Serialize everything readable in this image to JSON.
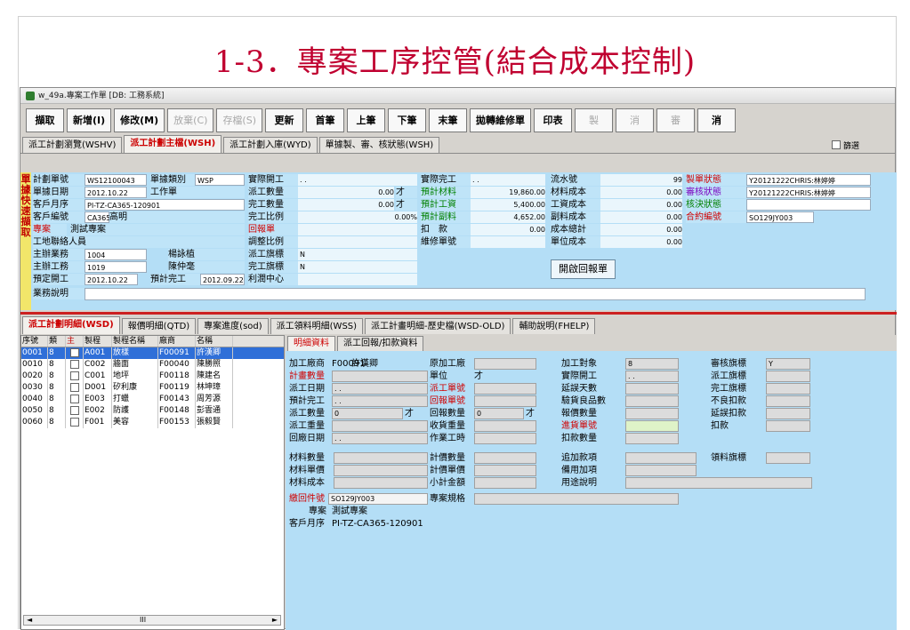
{
  "slide": {
    "title": "1-3．專案工序控管(結合成本控制)"
  },
  "window": {
    "title": "w_49a.專案工作單 [DB: 工務系統]"
  },
  "toolbar": [
    {
      "label": "擷取",
      "enabled": true
    },
    {
      "label": "新增(I)",
      "enabled": true
    },
    {
      "label": "修改(M)",
      "enabled": true
    },
    {
      "label": "放棄(C)",
      "enabled": false
    },
    {
      "label": "存檔(S)",
      "enabled": false
    },
    {
      "label": "更新",
      "enabled": true
    },
    {
      "label": "首筆",
      "enabled": true
    },
    {
      "label": "上筆",
      "enabled": true
    },
    {
      "label": "下筆",
      "enabled": true
    },
    {
      "label": "末筆",
      "enabled": true
    },
    {
      "label": "拋轉維修單",
      "enabled": true
    },
    {
      "label": "印表",
      "enabled": true
    },
    {
      "label": "製",
      "enabled": false
    },
    {
      "label": "消",
      "enabled": false
    },
    {
      "label": "審",
      "enabled": false
    },
    {
      "label": "消",
      "enabled": true
    }
  ],
  "top_tabs": [
    "派工計劃瀏覽(WSHV)",
    "派工計劃主檔(WSH)",
    "派工計劃入庫(WYD)",
    "單據製、審、核狀態(WSH)"
  ],
  "filter_label": "篩選",
  "sidebar_strip": "單據快速擷取",
  "header": {
    "plan_no_label": "計劃單號",
    "plan_no": "WS12100043",
    "doc_type_label": "單據類別",
    "doc_type": "WSP",
    "doc_date_label": "單據日期",
    "doc_date": "2012.10.22",
    "doc_type_name": "工作單",
    "cust_order_label": "客戶月序",
    "cust_order": "PI-TZ-CA365-120901",
    "cust_code_label": "客戶編號",
    "cust_code": "CA365",
    "cust_name": "高明",
    "project_label": "專案",
    "project": "測試專案",
    "site_contact_label": "工地聯絡人員",
    "sales_label": "主辦業務",
    "sales_code": "1004",
    "sales_name": "楊詠植",
    "engineer_label": "主辦工務",
    "engineer_code": "1019",
    "engineer_name": "陳仲毫",
    "planned_start_label": "預定開工",
    "planned_start": "2012.10.22",
    "planned_finish_label": "預計完工",
    "planned_finish": "2012.09.22",
    "notes_label": "業務說明",
    "actual_start_label": "實際開工",
    "actual_start": ". .",
    "dispatch_qty_label": "派工數量",
    "dispatch_qty": "0.00",
    "dispatch_unit": "才",
    "complete_qty_label": "完工數量",
    "complete_qty": "0.00",
    "complete_unit": "才",
    "complete_ratio_label": "完工比例",
    "complete_ratio": "0.00%",
    "return_doc_label": "回報單",
    "adjust_ratio_label": "調整比例",
    "dispatch_flag_label": "派工旗標",
    "dispatch_flag": "N",
    "complete_flag_label": "完工旗標",
    "complete_flag": "N",
    "profit_center_label": "利潤中心",
    "actual_finish_label": "實際完工",
    "actual_finish": ". .",
    "est_material_label": "預計材料",
    "est_material": "19,860.00",
    "est_labor_label": "預計工資",
    "est_labor": "5,400.00",
    "est_sub_label": "預計副料",
    "est_sub": "4,652.00",
    "deduct_label": "扣　款",
    "deduct": "0.00",
    "repair_no_label": "維修單號",
    "serial_label": "流水號",
    "serial": "99",
    "material_cost_label": "材料成本",
    "material_cost": "0.00",
    "labor_cost_label": "工資成本",
    "labor_cost": "0.00",
    "sub_cost_label": "副料成本",
    "sub_cost": "0.00",
    "total_cost_label": "成本總計",
    "total_cost": "0.00",
    "unit_cost_label": "單位成本",
    "unit_cost": "0.00",
    "open_report_button": "開啟回報單",
    "doc_status_label": "製單狀態",
    "doc_status": "Y20121222CHRIS:林婷婷",
    "review_status_label": "審核狀態",
    "review_status": "Y20121222CHRIS:林婷婷",
    "approve_status_label": "核決狀態",
    "contract_no_label": "合約編號",
    "contract_no": "SO129JY003"
  },
  "bottom_tabs": [
    "派工計劃明細(WSD)",
    "報價明細(QTD)",
    "專案進度(sod)",
    "派工領料明細(WSS)",
    "派工計畫明細-歷史檔(WSD-OLD)",
    "輔助說明(FHELP)"
  ],
  "grid": {
    "columns": [
      "序號",
      "類",
      "主",
      "製程",
      "製程名稱",
      "廠商",
      "名稱"
    ],
    "rows": [
      [
        "0001",
        "8",
        "",
        "A001",
        "放樣",
        "F00091",
        "許漢卿"
      ],
      [
        "0010",
        "8",
        "",
        "C002",
        "牆面",
        "F00040",
        "陳勝照"
      ],
      [
        "0020",
        "8",
        "",
        "C001",
        "地坪",
        "F00118",
        "陳建名"
      ],
      [
        "0030",
        "8",
        "",
        "D001",
        "矽利康",
        "F00119",
        "林坤璋"
      ],
      [
        "0040",
        "8",
        "",
        "E003",
        "打蠟",
        "F00143",
        "周芳源"
      ],
      [
        "0050",
        "8",
        "",
        "E002",
        "防護",
        "F00148",
        "彭雲通"
      ],
      [
        "0060",
        "8",
        "",
        "F001",
        "美容",
        "F00153",
        "張毅賢"
      ]
    ],
    "scroll_mark": "III"
  },
  "detail_tabs": [
    "明細資料",
    "派工回報/扣款資料"
  ],
  "detail": {
    "vendor_label": "加工廠商",
    "vendor_code": "F00091",
    "vendor_name": "許漢卿",
    "orig_vendor_label": "原加工廠",
    "target_label": "加工對象",
    "target": "8",
    "review_flag_label": "審核旗標",
    "review_flag": "Y",
    "plan_qty_label": "計畫數量",
    "unit_label": "單位",
    "unit": "才",
    "actual_start_label": "實際開工",
    "actual_start": ". .",
    "dispatch_flag_label": "派工旗標",
    "dispatch_date_label": "派工日期",
    "dispatch_date": ". .",
    "work_order_label": "派工單號",
    "delay_days_label": "延誤天數",
    "complete_flag_label": "完工旗標",
    "est_finish_label": "預計完工",
    "est_finish": ". .",
    "report_no_label": "回報單號",
    "accept_qty_label": "驗貨良品數",
    "defect_deduct_label": "不良扣款",
    "dispatch_qty_label": "派工數量",
    "dispatch_qty": "0",
    "dispatch_unit": "才",
    "report_qty_label": "回報數量",
    "report_qty": "0",
    "report_unit": "才",
    "defect_qty_label": "報價數量",
    "delay_deduct_label": "延誤扣款",
    "dispatch_weight_label": "派工重量",
    "receive_weight_label": "收貨重量",
    "incoming_no_label": "進貨單號",
    "deduct_label": "扣款",
    "return_date_label": "回廠日期",
    "return_date": ". .",
    "work_hours_label": "作業工時",
    "deduct_qty_label": "扣款數量",
    "material_qty_label": "材料數量",
    "price_qty_label": "計價數量",
    "extra_label": "追加款項",
    "material_flag_label": "領料旗標",
    "material_price_label": "材料單價",
    "price_unit_label": "計價單價",
    "reserve_label": "備用加項",
    "material_cost_label": "材料成本",
    "subtotal_label": "小計金額",
    "usage_label": "用途說明",
    "return_doc_label": "繳回件號",
    "return_doc": "SO129JY003",
    "project_spec_label": "專案規格",
    "project_label": "專案",
    "project": "測試專案",
    "cust_order_label": "客戶月序",
    "cust_order": "PI-TZ-CA365-120901"
  }
}
